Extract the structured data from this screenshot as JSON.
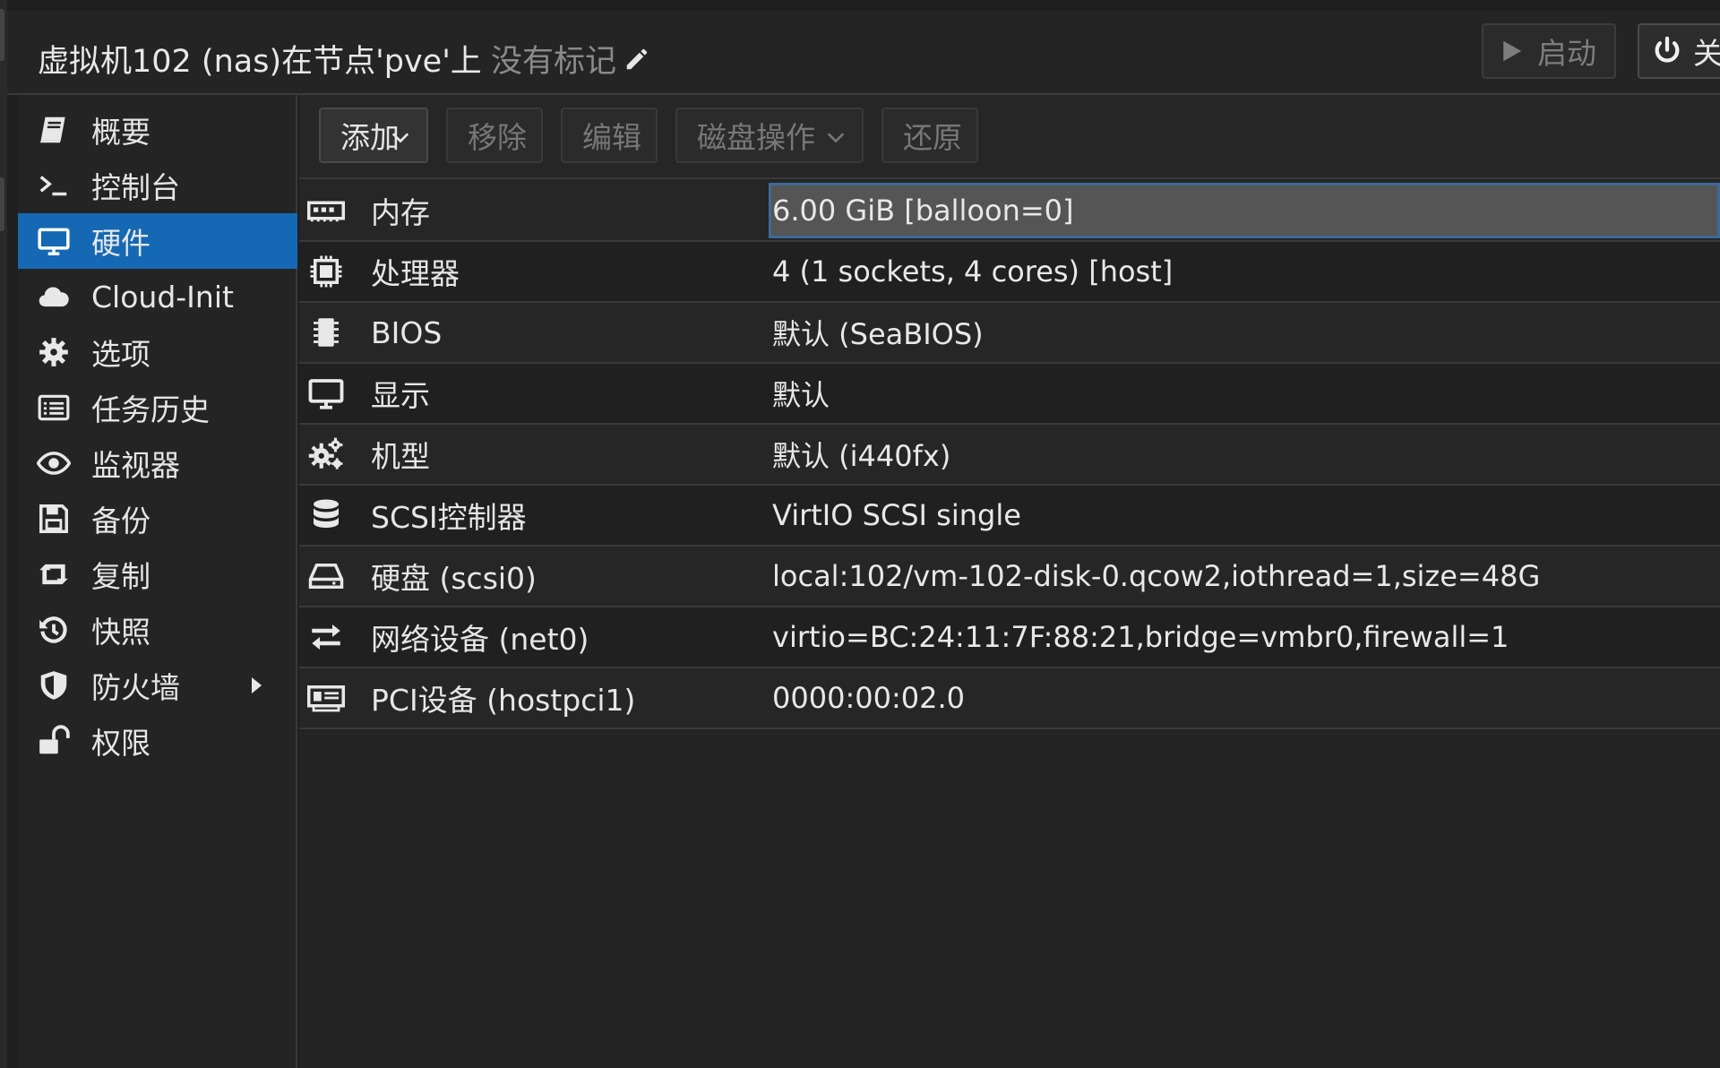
{
  "header": {
    "title": "虚拟机102 (nas)在节点'pve'上",
    "tags_label": "没有标记",
    "tags_icon": "pencil-icon",
    "start_label": "启动",
    "start_icon": "play-icon",
    "shutdown_label": "关",
    "shutdown_icon": "power-icon"
  },
  "sidebar": {
    "items": [
      {
        "label": "概要",
        "icon": "book-icon"
      },
      {
        "label": "控制台",
        "icon": "terminal-icon"
      },
      {
        "label": "硬件",
        "icon": "desktop-icon",
        "active": true
      },
      {
        "label": "Cloud-Init",
        "icon": "cloud-icon"
      },
      {
        "label": "选项",
        "icon": "gear-icon"
      },
      {
        "label": "任务历史",
        "icon": "list-icon"
      },
      {
        "label": "监视器",
        "icon": "eye-icon"
      },
      {
        "label": "备份",
        "icon": "floppy-icon"
      },
      {
        "label": "复制",
        "icon": "retweet-icon"
      },
      {
        "label": "快照",
        "icon": "history-icon"
      },
      {
        "label": "防火墙",
        "icon": "shield-icon",
        "has_submenu": true
      },
      {
        "label": "权限",
        "icon": "unlock-icon"
      }
    ]
  },
  "toolbar": {
    "add_label": "添加",
    "remove_label": "移除",
    "edit_label": "编辑",
    "disk_action_label": "磁盘操作",
    "revert_label": "还原"
  },
  "hardware": {
    "rows": [
      {
        "name": "内存",
        "value": "6.00 GiB [balloon=0]",
        "icon": "memory-icon",
        "selected": true
      },
      {
        "name": "处理器",
        "value": "4 (1 sockets, 4 cores) [host]",
        "icon": "cpu-icon"
      },
      {
        "name": "BIOS",
        "value": "默认 (SeaBIOS)",
        "icon": "microchip-icon"
      },
      {
        "name": "显示",
        "value": "默认",
        "icon": "desktop-icon"
      },
      {
        "name": "机型",
        "value": "默认 (i440fx)",
        "icon": "cogs-icon"
      },
      {
        "name": "SCSI控制器",
        "value": "VirtIO SCSI single",
        "icon": "database-icon"
      },
      {
        "name": "硬盘 (scsi0)",
        "value": "local:102/vm-102-disk-0.qcow2,iothread=1,size=48G",
        "icon": "hdd-icon"
      },
      {
        "name": "网络设备 (net0)",
        "value": "virtio=BC:24:11:7F:88:21,bridge=vmbr0,firewall=1",
        "icon": "exchange-icon"
      },
      {
        "name": "PCI设备 (hostpci1)",
        "value": "0000:00:02.0",
        "icon": "pci-card-icon"
      }
    ]
  },
  "colors": {
    "active_nav": "#1568b3",
    "selected_border": "#3d6a96"
  }
}
